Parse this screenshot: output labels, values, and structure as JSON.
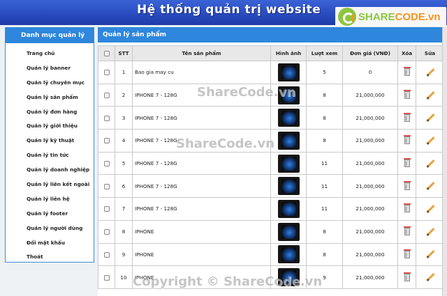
{
  "header": {
    "title": "Hệ thống quản trị website",
    "logo_text_a": "SHARE",
    "logo_text_b": "CODE.vn"
  },
  "sidebar": {
    "title": "Danh mục quản lý",
    "items": [
      {
        "label": "Trang chủ"
      },
      {
        "label": "Quản lý banner"
      },
      {
        "label": "Quản lý chuyên mục"
      },
      {
        "label": "Quản lý sản phẩm"
      },
      {
        "label": "Quản lý đơn hàng"
      },
      {
        "label": "Quản lý giới thiệu"
      },
      {
        "label": "Quản lý kỹ thuật"
      },
      {
        "label": "Quản lý tin tức"
      },
      {
        "label": "Quản lý doanh nghiệp"
      },
      {
        "label": "Quản lý liên kết ngoài"
      },
      {
        "label": "Quản lý liên hệ"
      },
      {
        "label": "Quản lý footer"
      },
      {
        "label": "Quản lý người dùng"
      },
      {
        "label": "Đổi mật khẩu"
      },
      {
        "label": "Thoát"
      }
    ]
  },
  "main": {
    "title": "Quản lý sản phẩm",
    "columns": [
      "",
      "STT",
      "Tên sản phẩm",
      "Hình ảnh",
      "Lượt xem",
      "Đơn giá (VNĐ)",
      "Xóa",
      "Sửa"
    ],
    "rows": [
      {
        "stt": "1",
        "name": "Bao gia may cu",
        "views": "5",
        "price": "0"
      },
      {
        "stt": "2",
        "name": "IPHONE 7 - 128G",
        "views": "8",
        "price": "21,000,000"
      },
      {
        "stt": "3",
        "name": "IPHONE 7 - 128G",
        "views": "8",
        "price": "21,000,000"
      },
      {
        "stt": "4",
        "name": "IPHONE 7 - 128G",
        "views": "8",
        "price": "21,000,000"
      },
      {
        "stt": "5",
        "name": "IPHONE 7 - 128G",
        "views": "11",
        "price": "21,000,000"
      },
      {
        "stt": "6",
        "name": "IPHONE 7 - 128G",
        "views": "11",
        "price": "21,000,000"
      },
      {
        "stt": "7",
        "name": "IPHONE 7 - 128G",
        "views": "11",
        "price": "21,000,000"
      },
      {
        "stt": "8",
        "name": "IPHONE",
        "views": "8",
        "price": "21,000,000"
      },
      {
        "stt": "9",
        "name": "IPHONE",
        "views": "8",
        "price": "21,000,000"
      },
      {
        "stt": "10",
        "name": "IPHONE",
        "views": "9",
        "price": "21,000,000"
      }
    ]
  },
  "watermarks": [
    "ShareCode.vn",
    "ShareCode.vn",
    "Copyright © ShareCode.vn"
  ]
}
